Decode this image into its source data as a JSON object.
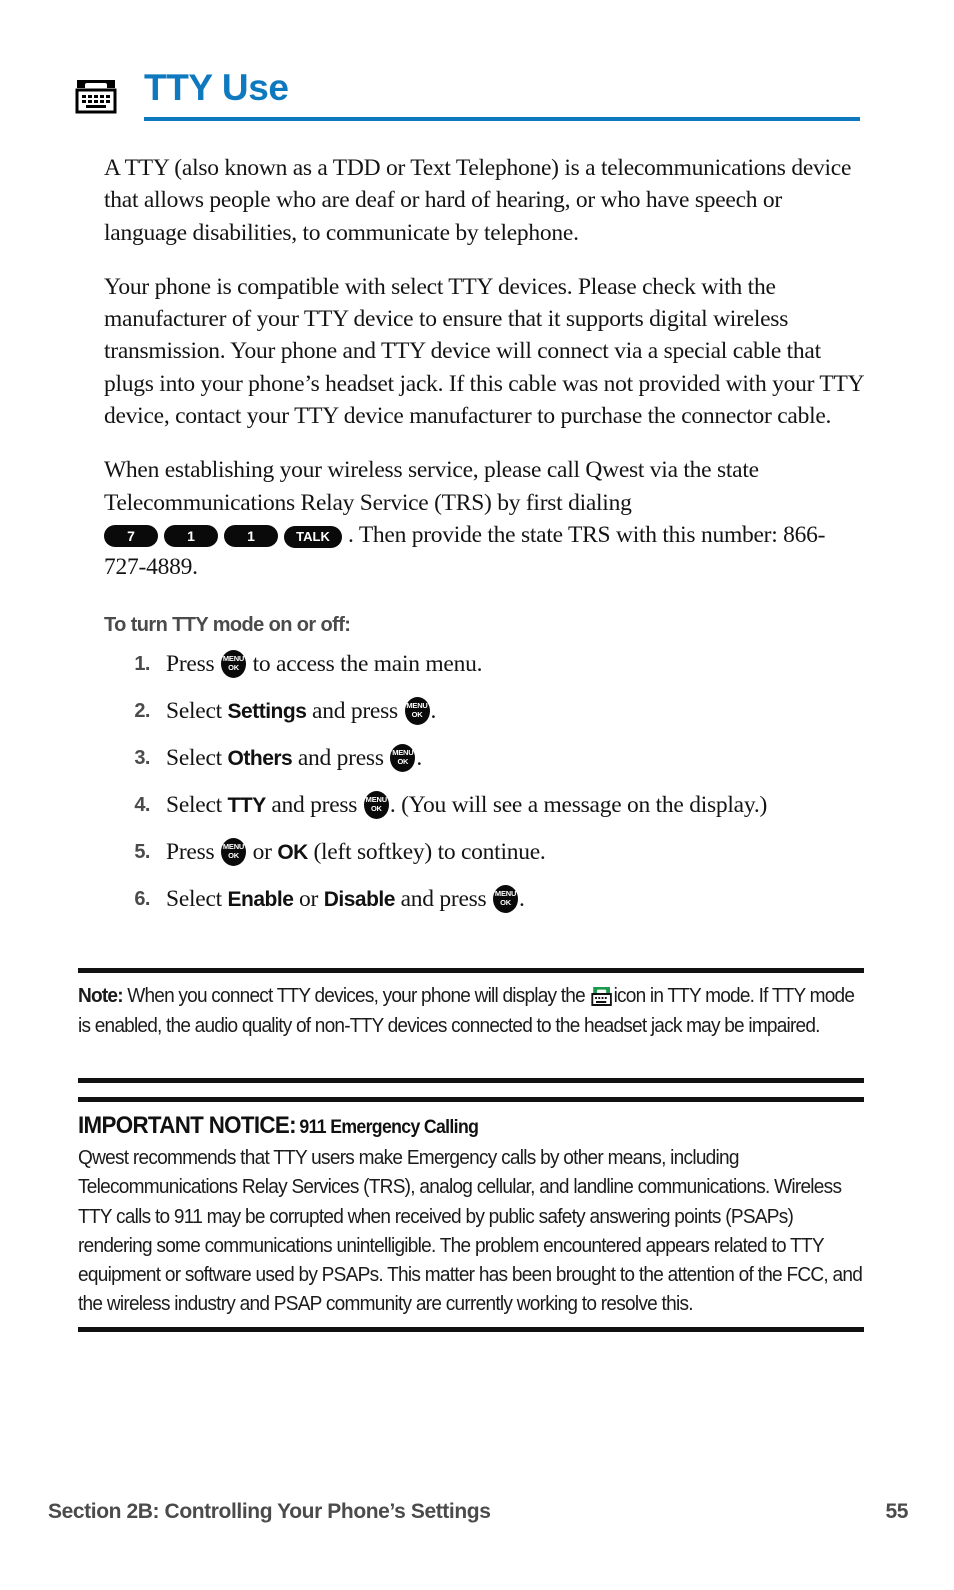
{
  "header": {
    "title": "TTY Use",
    "icon": "tty-machine-icon",
    "accent_color": "#0e79be"
  },
  "paragraphs": [
    "A TTY (also known as a TDD or Text Telephone) is a telecommunications device that allows people who are deaf or hard of hearing, or who have speech or language disabilities, to communicate by telephone.",
    "Your phone is compatible with select TTY devices. Please check with the manufacturer of your TTY device to ensure that it supports digital wireless transmission. Your phone and TTY device will connect via a special cable that plugs into your phone’s headset jack. If this cable was not provided with your TTY device, contact your TTY device manufacturer to purchase the connector cable."
  ],
  "dial_paragraph": {
    "lead": "When establishing your wireless service, please call Qwest via the state Telecommunications Relay Service (TRS) by first dialing",
    "keys": [
      "7",
      "1",
      "1",
      "TALK"
    ],
    "tail": ". Then provide the state TRS with this number: 866-727-4889."
  },
  "subhead": "To turn TTY mode on or off:",
  "menu_key": {
    "line1": "MENU",
    "line2": "OK"
  },
  "steps": [
    {
      "num": "1.",
      "pre": "Press ",
      "bold1": "",
      "mid": "",
      "bold2": "",
      "post": " to access the main menu."
    },
    {
      "num": "2.",
      "pre": "Select ",
      "bold1": "Settings",
      "mid": " and press ",
      "bold2": "",
      "post": "."
    },
    {
      "num": "3.",
      "pre": "Select ",
      "bold1": "Others",
      "mid": " and press ",
      "bold2": "",
      "post": "."
    },
    {
      "num": "4.",
      "pre": "Select ",
      "bold1": "TTY",
      "mid": " and press ",
      "bold2": "",
      "post": ". (You will see a message on the display.)"
    },
    {
      "num": "5.",
      "pre": "Press ",
      "bold1": "",
      "mid": "",
      "bold2": "",
      "post": ""
    },
    {
      "num": "6.",
      "pre": "Select ",
      "bold1": "Enable",
      "mid": " or ",
      "bold2": "Disable",
      "post": " and press "
    }
  ],
  "step5": {
    "pre": "Press ",
    "or": " or ",
    "ok_bold": "OK",
    "post": " (left softkey) to continue."
  },
  "step6_tail": ".",
  "note": {
    "label": "Note:",
    "text_before_icon": " When you connect TTY devices, your phone will display the ",
    "icon": "tty-status-icon",
    "text_after_icon": "icon in TTY mode. If TTY mode is enabled, the audio quality of non-TTY devices connected to the headset jack may be impaired."
  },
  "notice": {
    "heading_main": "IMPORTANT NOTICE:",
    "heading_sub": "911 Emergency Calling",
    "body": "Qwest recommends that TTY users make Emergency calls by other means, including Telecommunications Relay Services (TRS), analog cellular, and landline communications. Wireless TTY calls to 911 may be corrupted when received by public safety answering points (PSAPs) rendering some communications unintelligible. The problem encountered appears related to TTY equipment or software used by PSAPs. This matter has been brought to the attention of the FCC, and the wireless industry and PSAP community are currently working to resolve this."
  },
  "footer": {
    "section": "Section 2B: Controlling Your Phone’s Settings",
    "page": "55"
  }
}
